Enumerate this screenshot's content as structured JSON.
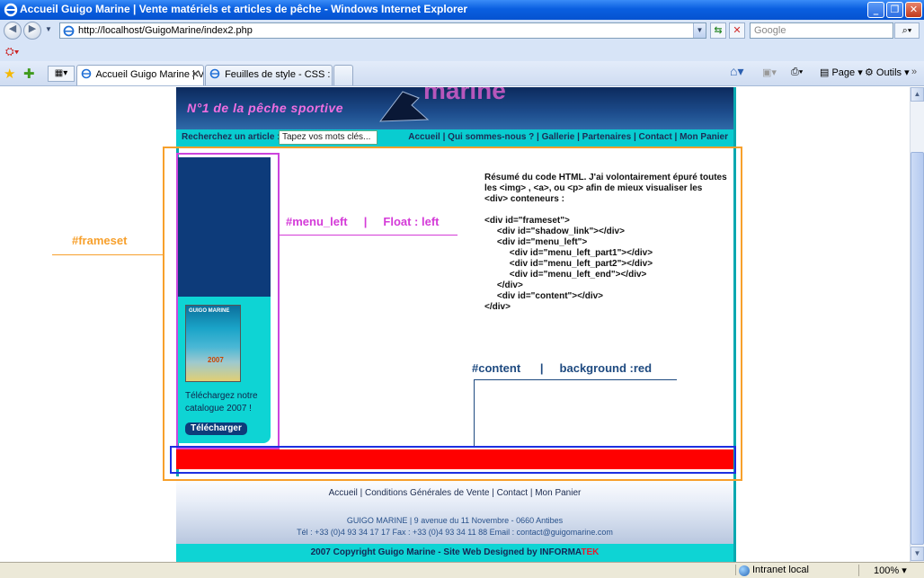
{
  "window": {
    "title": "Accueil Guigo Marine | Vente matériels et articles de pêche - Windows Internet Explorer",
    "minimize": "_",
    "maximize": "❐",
    "close": "✕"
  },
  "address": {
    "url": "http://localhost/GuigoMarine/index2.php",
    "search_placeholder": "Google"
  },
  "tabs": [
    {
      "label": "Accueil Guigo Marine | Ve...",
      "active": true
    },
    {
      "label": "Feuilles de style - CSS : FLO...",
      "active": false
    }
  ],
  "commands": {
    "page": "Page",
    "tools": "Outils"
  },
  "status": {
    "zone": "Intranet local",
    "zoom": "100%"
  },
  "site": {
    "slogan": "N°1 de la pêche sportive",
    "search_label": "Recherchez un article :",
    "search_placeholder": "Tapez vos mots clés...",
    "nav": "Accueil | Qui sommes-nous ? | Gallerie | Partenaires | Contact | Mon Panier",
    "catalog_title": "GUIGO MARINE",
    "catalog_year": "2007",
    "download_text": "Téléchargez notre catalogue 2007 !",
    "download_button": "Télécharger",
    "footer_links": "Accueil | Conditions Générales de Vente | Contact | Mon Panier",
    "footer_address": "GUIGO MARINE | 9 avenue du 11 Novembre - 0660 Antibes",
    "footer_contact": "Tél : +33 (0)4 93 34 17 17 Fax : +33 (0)4 93 34 11 88 Email : contact@guigomarine.com",
    "copyright_main": "2007 Copyright Guigo Marine - Site Web Designed by INFORMA",
    "copyright_tek": "TEK"
  },
  "annotations": {
    "frameset": "#frameset",
    "menu_left": "#menu_left     |     Float : left",
    "content": "#content      |     background :red",
    "code_intro": "Résumé du code HTML.  J'ai volontairement épuré toutes les <img> , <a>, ou <p> afin de mieux visualiser les <div> conteneurs :",
    "code_lines": [
      "<div id=\"frameset\">",
      "     <div id=\"shadow_link\"></div>",
      "     <div id=\"menu_left\">",
      "          <div id=\"menu_left_part1\"></div>",
      "          <div id=\"menu_left_part2\"></div>",
      "          <div id=\"menu_left_end\"></div>",
      "     </div>",
      "     <div id=\"content\"></div>",
      "</div>"
    ]
  },
  "colors": {
    "frameset_border": "#f7a02c",
    "menu_left_border": "#cc44dd",
    "content_label": "#1e4a80",
    "red_box_border": "#1c2fe0",
    "content_background": "#ff0000"
  }
}
